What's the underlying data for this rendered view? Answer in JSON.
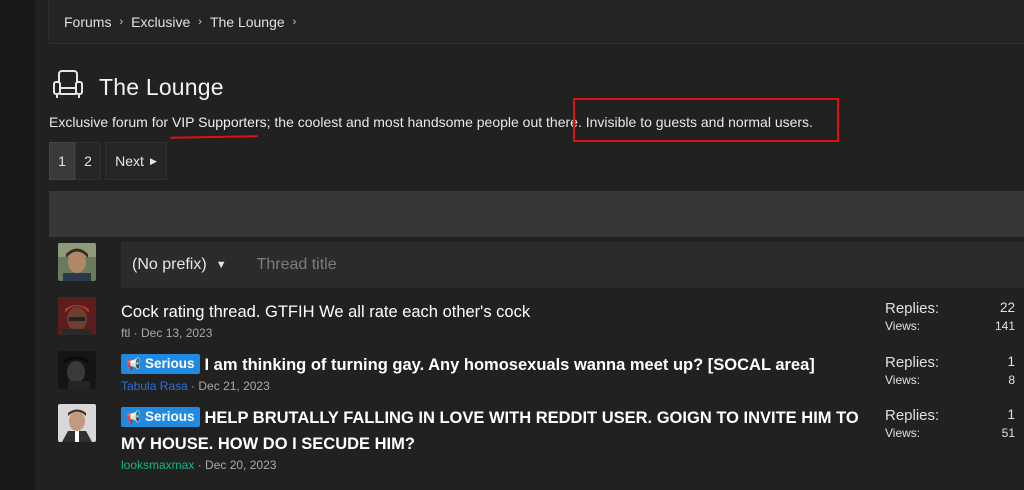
{
  "breadcrumb": {
    "items": [
      "Forums",
      "Exclusive",
      "The Lounge"
    ],
    "separator": "›"
  },
  "page": {
    "icon": "armchair-icon",
    "title": "The Lounge",
    "description_prefix": "Exclusive forum for ",
    "description_link": "VIP Supporters",
    "description_suffix": "; the coolest and most handsome people out there. Invisible to guests and normal users."
  },
  "pagination": {
    "pages": [
      "1",
      "2"
    ],
    "current": "1",
    "next_label": "Next"
  },
  "new_thread": {
    "prefix_label": "(No prefix)",
    "title_placeholder": "Thread title"
  },
  "threads": [
    {
      "prefix": "",
      "title": "Cock rating thread. GTFIH We all rate each other's cock",
      "author": "ftl",
      "date": "Dec 13, 2023",
      "replies_label": "Replies:",
      "replies": "22",
      "views_label": "Views:",
      "views": "141"
    },
    {
      "prefix": "Serious",
      "title": "I am thinking of turning gay. Any homosexuals wanna meet up? [SOCAL area]",
      "author": "Tabula Rasa",
      "date": "Dec 21, 2023",
      "replies_label": "Replies:",
      "replies": "1",
      "views_label": "Views:",
      "views": "8"
    },
    {
      "prefix": "Serious",
      "title": "HELP BRUTALLY FALLING IN LOVE WITH REDDIT USER. GOIGN TO INVITE HIM TO MY HOUSE. HOW DO I SECUDE HIM?",
      "author": "looksmaxmax",
      "date": "Dec 20, 2023",
      "replies_label": "Replies:",
      "replies": "1",
      "views_label": "Views:",
      "views": "51"
    }
  ],
  "colors": {
    "background": "#212121",
    "badge": "#1f8ae0",
    "annotation": "#e01010",
    "author_blue": "#2a6fd9",
    "author_green": "#14b48a"
  }
}
